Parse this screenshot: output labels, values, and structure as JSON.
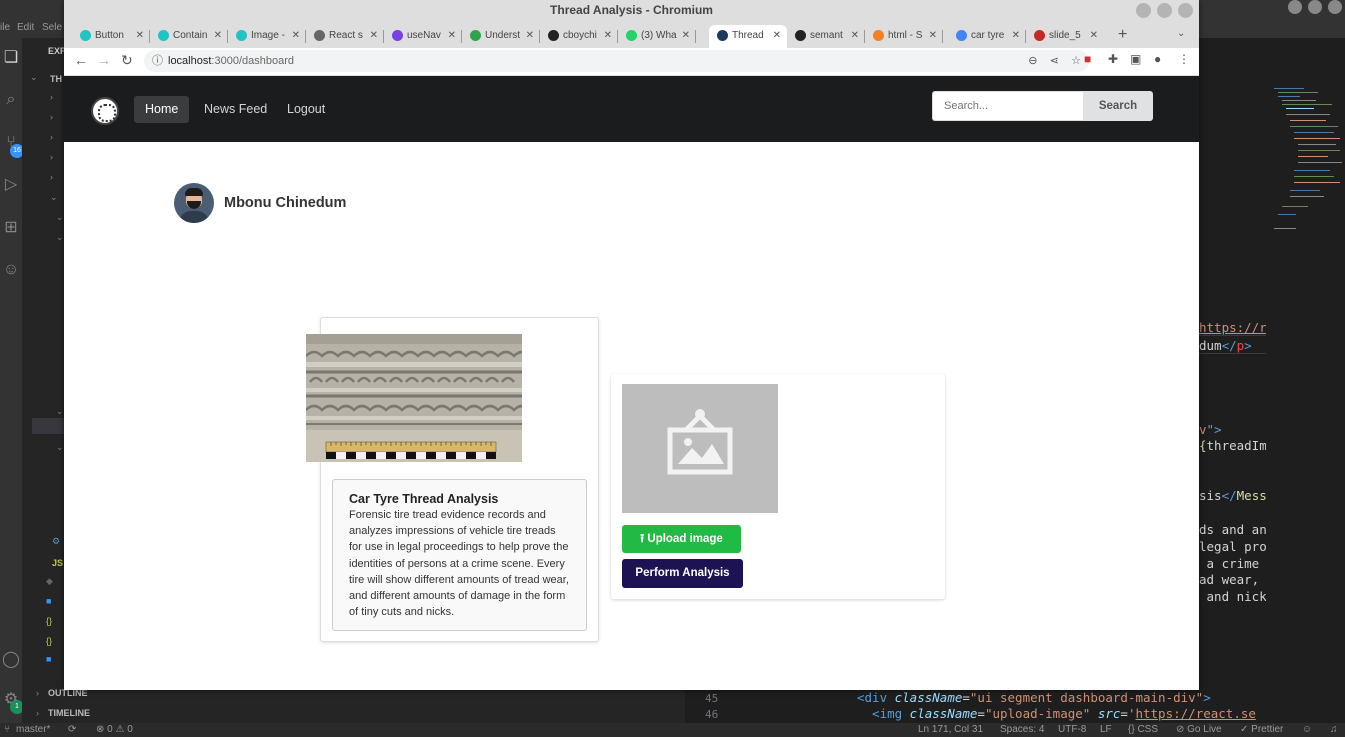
{
  "vscode": {
    "menu": [
      "ile",
      "Edit",
      "Sele"
    ],
    "sidebar_header": "EXP",
    "sidebar_root": "TH",
    "explorer_sections": [
      "OUTLINE",
      "TIMELINE"
    ],
    "source_control_count": "16",
    "accounts_count": "1",
    "code_lines": [
      {
        "parts": [
          {
            "t": "https://re",
            "c": "c-url"
          }
        ]
      },
      {
        "parts": [
          {
            "t": "dum",
            "c": ""
          },
          {
            "t": "</",
            "c": "c-tag"
          },
          {
            "t": "p",
            "c": "c-tag2"
          },
          {
            "t": ">",
            "c": "c-tag"
          }
        ]
      },
      {
        "parts": [
          {
            "t": "v",
            "c": "c-str"
          },
          {
            "t": "\">",
            "c": "c-tag"
          }
        ]
      },
      {
        "parts": [
          {
            "t": "{",
            "c": "c-fn"
          },
          {
            "t": "threadIm",
            "c": ""
          }
        ]
      },
      {
        "parts": [
          {
            "t": "sis",
            "c": ""
          },
          {
            "t": "</",
            "c": "c-tag"
          },
          {
            "t": "Mess",
            "c": "c-fn"
          }
        ]
      },
      {
        "parts": [
          {
            "t": "ds and an",
            "c": ""
          }
        ]
      },
      {
        "parts": [
          {
            "t": "legal pro",
            "c": ""
          }
        ]
      },
      {
        "parts": [
          {
            "t": " a crime",
            "c": ""
          }
        ]
      },
      {
        "parts": [
          {
            "t": "ad wear, ",
            "c": ""
          }
        ]
      },
      {
        "parts": [
          {
            "t": " and nick",
            "c": ""
          }
        ]
      }
    ],
    "bottom_line_numbers": [
      "45",
      "46"
    ],
    "bottom_code": [
      {
        "parts": [
          {
            "t": "<",
            "c": "c-tag"
          },
          {
            "t": "div",
            "c": "c-tag"
          },
          {
            "t": " className",
            "c": "c-attr"
          },
          {
            "t": "=",
            "c": ""
          },
          {
            "t": "\"ui segment dashboard-main-div\"",
            "c": "c-str"
          },
          {
            "t": ">",
            "c": "c-tag"
          }
        ]
      },
      {
        "parts": [
          {
            "t": "  <",
            "c": "c-tag"
          },
          {
            "t": "img",
            "c": "c-tag"
          },
          {
            "t": " className",
            "c": "c-attr"
          },
          {
            "t": "=",
            "c": ""
          },
          {
            "t": "\"upload-image\"",
            "c": "c-str"
          },
          {
            "t": " src",
            "c": "c-attr"
          },
          {
            "t": "=",
            "c": ""
          },
          {
            "t": "'",
            "c": "c-str"
          },
          {
            "t": "https://react.se",
            "c": "c-url"
          }
        ]
      }
    ],
    "status": {
      "branch": "master*",
      "problems": "⊗ 0 ⚠ 0",
      "position": "Ln 171, Col 31",
      "spaces": "Spaces: 4",
      "encoding": "UTF-8",
      "eol": "LF",
      "language": "{} CSS",
      "golive": "⊘ Go Live",
      "prettier": "✓ Prettier"
    }
  },
  "browser": {
    "window_title": "Thread Analysis - Chromium",
    "tabs": [
      {
        "label": "Button",
        "icon_color": "#20c4c4"
      },
      {
        "label": "Contain",
        "icon_color": "#20c4c4"
      },
      {
        "label": "Image -",
        "icon_color": "#20c4c4"
      },
      {
        "label": "React s",
        "icon_color": "#666666"
      },
      {
        "label": "useNav",
        "icon_color": "#7b3fe4"
      },
      {
        "label": "Underst",
        "icon_color": "#2ea44f"
      },
      {
        "label": "cboychi",
        "icon_color": "#222222"
      },
      {
        "label": "(3) Wha",
        "icon_color": "#25d366"
      },
      {
        "label": "Thread",
        "icon_color": "#1e3a5f",
        "active": true
      },
      {
        "label": "semant",
        "icon_color": "#222222"
      },
      {
        "label": "html - S",
        "icon_color": "#f48024"
      },
      {
        "label": "car tyre",
        "icon_color": "#4285f4"
      },
      {
        "label": "slide_5",
        "icon_color": "#c62828"
      }
    ],
    "url_host": "localhost",
    "url_path": ":3000/dashboard"
  },
  "navbar": {
    "items": [
      "Home",
      "News Feed",
      "Logout"
    ],
    "active_index": 0,
    "search_placeholder": "Search...",
    "search_button": "Search"
  },
  "profile": {
    "name": "Mbonu Chinedum"
  },
  "card": {
    "title": "Car Tyre Thread Analysis",
    "description": "Forensic tire tread evidence records and analyzes impressions of vehicle tire treads for use in legal proceedings to help prove the identities of persons at a crime scene. Every tire will show different amounts of tread wear, and different amounts of damage in the form of tiny cuts and nicks."
  },
  "upload_panel": {
    "upload_button": "Upload image",
    "analysis_button": "Perform Analysis"
  },
  "colors": {
    "navbar_bg": "#1b1c1d",
    "upload_green": "#21ba45",
    "analysis_navy": "#1e1352",
    "placeholder_gray": "#bdbdbe"
  }
}
